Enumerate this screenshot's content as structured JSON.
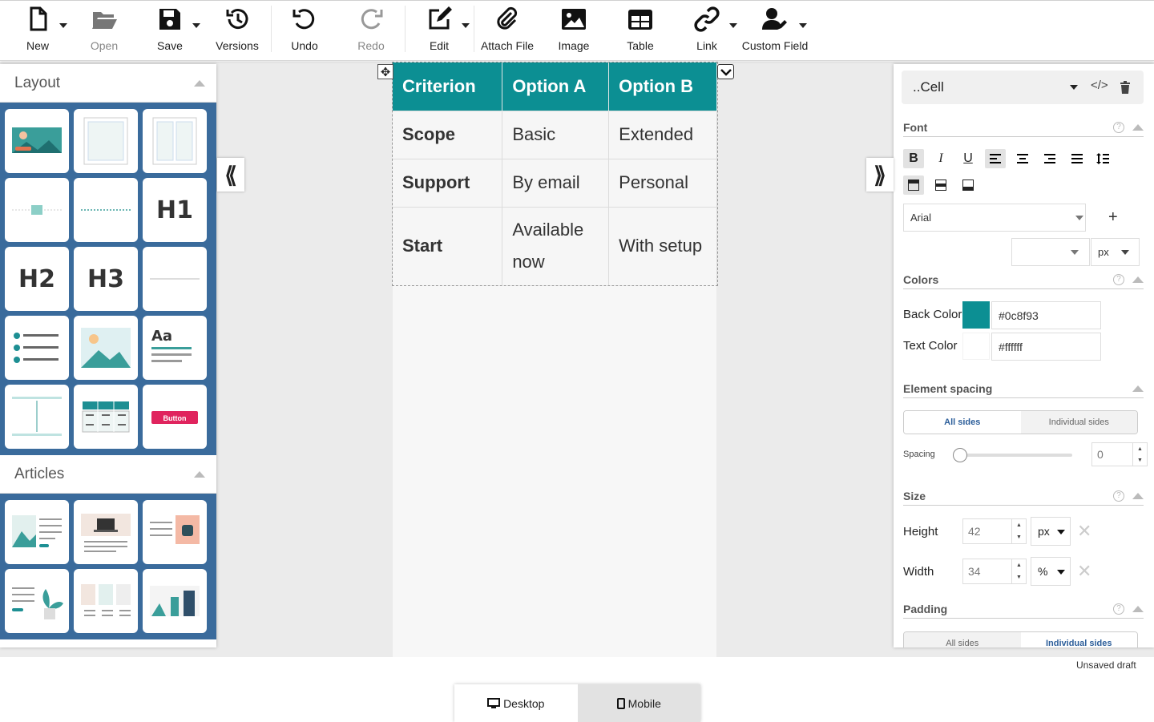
{
  "toolbar": {
    "new": "New",
    "open": "Open",
    "save": "Save",
    "versions": "Versions",
    "undo": "Undo",
    "redo": "Redo",
    "edit": "Edit",
    "attach": "Attach File",
    "image": "Image",
    "table": "Table",
    "link": "Link",
    "custom_field": "Custom Field"
  },
  "left_panel": {
    "layout_title": "Layout",
    "articles_title": "Articles",
    "tiles": {
      "h1": "H1",
      "h2": "H2",
      "h3": "H3",
      "aa": "Aa",
      "button": "Button"
    }
  },
  "table": {
    "headers": [
      "Criterion",
      "Option A",
      "Option B"
    ],
    "rows": [
      [
        "Scope",
        "Basic",
        "Extended"
      ],
      [
        "Support",
        "By email",
        "Personal"
      ],
      [
        "Start",
        "Available now",
        "With setup"
      ]
    ]
  },
  "right_panel": {
    "selector": "..Cell",
    "font_section": "Font",
    "font_family": "Arial",
    "font_unit": "px",
    "colors_section": "Colors",
    "back_color_label": "Back Color",
    "back_color_value": "#0c8f93",
    "text_color_label": "Text Color",
    "text_color_value": "#ffffff",
    "spacing_section": "Element spacing",
    "all_sides": "All sides",
    "individual_sides": "Individual sides",
    "spacing_label": "Spacing",
    "spacing_value": "0",
    "spacing_slider_level": 0,
    "size_section": "Size",
    "height_label": "Height",
    "height_value": "42",
    "height_unit": "px",
    "width_label": "Width",
    "width_value": "34",
    "width_unit": "%",
    "padding_section": "Padding",
    "padding_all_sides": "All sides",
    "padding_individual_sides": "Individual sides"
  },
  "status": {
    "unsaved": "Unsaved draft"
  },
  "device": {
    "desktop": "Desktop",
    "mobile": "Mobile"
  },
  "colors": {
    "accent": "#0c8f93",
    "panel_blue": "#3a6b9c",
    "link_blue": "#2c5e9a"
  }
}
